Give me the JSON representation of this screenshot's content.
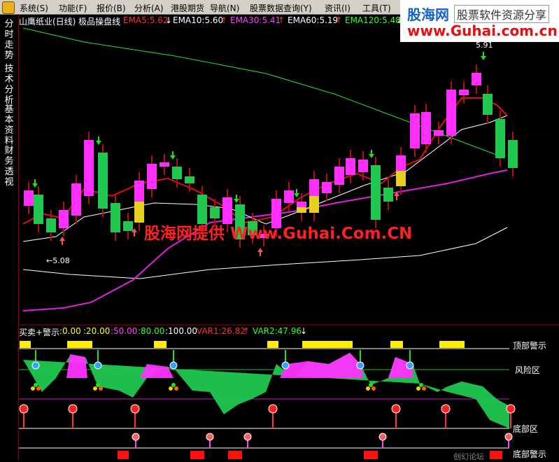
{
  "menu": {
    "items": [
      "系统(S)",
      "功能(F)",
      "报价(B)",
      "分析(A)",
      "港股期货",
      "导航(N)",
      "股票数据查询(Y)",
      "资讯(I)",
      "工具(T)"
    ]
  },
  "logo": {
    "brand": "股海网",
    "tagline": "股票软件资源分享",
    "url": "www.Guhai.com.cn"
  },
  "sidebar": {
    "tabs": [
      "分时走势",
      "技术分析",
      "基本资料",
      "财务透视"
    ]
  },
  "header": {
    "title": "山鹰纸业(日线) 极品操盘线",
    "ema5": "EMA5:5.62",
    "ema10": "EMA10:5.60",
    "ema30": "EMA30:5.41",
    "ema60": "EMA60:5.19",
    "ema120": "EMA120:5.48",
    "arrow_down": "↓",
    "arrow_up": "↑",
    "colors": {
      "title": "#ffffff",
      "ema5": "#ff3030",
      "ema10": "#ffffff",
      "ema30": "#ff40ff",
      "ema60": "#ffffff",
      "ema120": "#30ff30"
    }
  },
  "price_labels": {
    "high": "5.91",
    "low": "←5.08"
  },
  "watermark": "股海网提供 Www.Guhai.Com.CN",
  "sub_header": {
    "title": "买卖+警示",
    "v0": ":0.00",
    "v20": ":20.00",
    "v50": ":50.00",
    "v80": ":80.00",
    "v100": ":100.00",
    "var1": "VAR1:26.82",
    "var2": "VAR2:47.96",
    "arrow_up": "↑",
    "arrow_down": "↓",
    "colors": {
      "v0": "#ffff00",
      "v20": "#ffff00",
      "v50": "#ff40ff",
      "v80": "#30ff30",
      "v100": "#ffffff",
      "var1": "#ff3030",
      "var2": "#30ff30"
    }
  },
  "zones": {
    "top": "顶部警示",
    "risk": "风险区",
    "bottom": "底部区",
    "bottom_alert": "底部警示"
  },
  "footer_text": "创幻论坛",
  "colors": {
    "bull": "#ff30ff",
    "bear": "#20c850",
    "doji_yellow": "#e8d020",
    "ema5": "#e01010",
    "ema30": "#e020e0",
    "ema10": "#ffffff",
    "ema120": "#30e030"
  }
}
